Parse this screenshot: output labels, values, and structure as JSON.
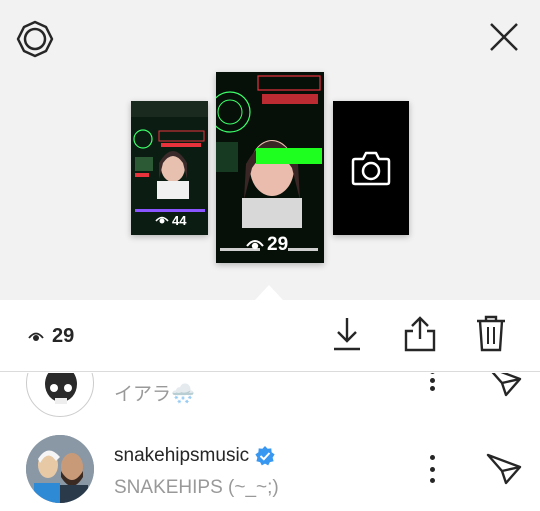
{
  "header": {
    "settings_icon": "gear-icon",
    "close_icon": "close-icon"
  },
  "stories": [
    {
      "views": "44",
      "thumbnail": "green-glitch-story"
    },
    {
      "views": "29",
      "thumbnail": "green-glitch-story-selected",
      "selected": true
    },
    {
      "type": "camera",
      "icon": "camera-icon"
    }
  ],
  "action_bar": {
    "view_count": "29",
    "actions": [
      "download-icon",
      "share-icon",
      "delete-icon"
    ]
  },
  "viewers": [
    {
      "username": "",
      "full_name": "イアラ🌨️",
      "verified": false
    },
    {
      "username": "snakehipsmusic",
      "full_name": "SNAKEHIPS (~_~;)",
      "verified": true
    }
  ],
  "colors": {
    "accent_blue": "#3897f0",
    "text_primary": "#262626",
    "text_secondary": "#999999",
    "panel_bg": "#f2f2f2"
  }
}
